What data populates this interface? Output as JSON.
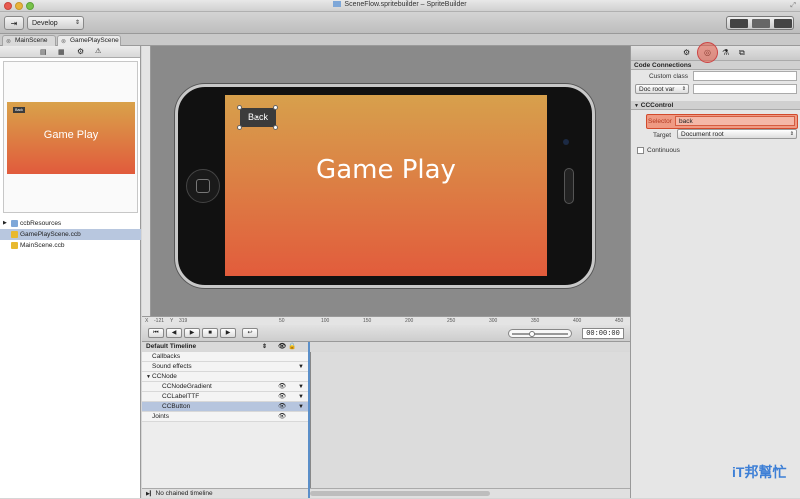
{
  "window": {
    "title": "SceneFlow.spritebuilder – SpriteBuilder"
  },
  "toolbar": {
    "scheme": "Develop"
  },
  "tabs": [
    {
      "label": "MainScene"
    },
    {
      "label": "GamePlayScene"
    }
  ],
  "preview": {
    "back_label": "Back",
    "title": "Game Play"
  },
  "files": [
    {
      "name": "ccbResources",
      "type": "folder"
    },
    {
      "name": "GamePlayScene.ccb",
      "type": "file",
      "selected": true
    },
    {
      "name": "MainScene.ccb",
      "type": "file"
    }
  ],
  "stage": {
    "title": "Game Play",
    "back_label": "Back"
  },
  "ruler": {
    "x_label": "X",
    "x_value": "-121",
    "y_label": "Y",
    "y_value": "319",
    "ticks": [
      "50",
      "100",
      "150",
      "200",
      "250",
      "300",
      "350",
      "400",
      "450",
      "500",
      "550",
      "600",
      "650"
    ]
  },
  "timeline": {
    "clock": "00:00:00",
    "header": "Default Timeline",
    "rows": [
      {
        "label": "Callbacks"
      },
      {
        "label": "Sound effects"
      },
      {
        "label": "CCNode"
      },
      {
        "label": "CCNodeGradient"
      },
      {
        "label": "CCLabelTTF"
      },
      {
        "label": "CCButton"
      },
      {
        "label": "Joints"
      }
    ],
    "chained": "No chained timeline"
  },
  "inspector": {
    "code_connections": "Code Connections",
    "custom_class_label": "Custom class",
    "doc_root_var": "Doc root var",
    "cccontrol": "CCControl",
    "selector_label": "Selector",
    "selector_value": "back",
    "target_label": "Target",
    "target_value": "Document root",
    "continuous": "Continuous"
  },
  "watermark": "iT邦幫忙"
}
